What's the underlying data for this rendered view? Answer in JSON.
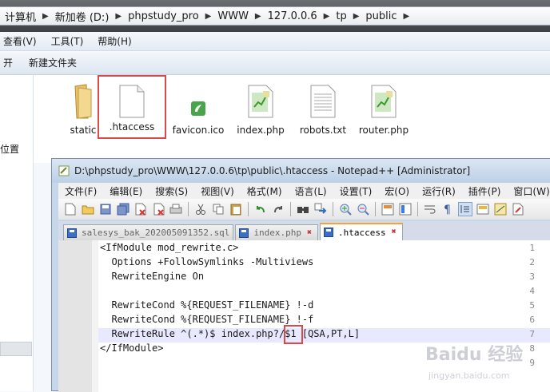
{
  "explorer": {
    "breadcrumbs": [
      "计算机",
      "新加卷 (D:)",
      "phpstudy_pro",
      "WWW",
      "127.0.0.6",
      "tp",
      "public"
    ],
    "menu": [
      "查看(V)",
      "工具(T)",
      "帮助(H)"
    ],
    "commands": [
      "开",
      "新建文件夹"
    ],
    "nav_label": "位置",
    "files": [
      {
        "name": "static",
        "icon": "folder-icon"
      },
      {
        "name": ".htaccess",
        "icon": "blank-file-icon"
      },
      {
        "name": "favicon.ico",
        "icon": "favicon-icon"
      },
      {
        "name": "index.php",
        "icon": "php-file-icon"
      },
      {
        "name": "robots.txt",
        "icon": "text-file-icon"
      },
      {
        "name": "router.php",
        "icon": "php-file-icon"
      }
    ]
  },
  "notepad": {
    "title": "D:\\phpstudy_pro\\WWW\\127.0.0.6\\tp\\public\\.htaccess - Notepad++ [Administrator]",
    "menu": [
      "文件(F)",
      "编辑(E)",
      "搜索(S)",
      "视图(V)",
      "格式(M)",
      "语言(L)",
      "设置(T)",
      "宏(O)",
      "运行(R)",
      "插件(P)",
      "窗口(W)",
      "?"
    ],
    "tabs": [
      "salesys_bak_202005091352.sql",
      "index.php",
      ".htaccess"
    ],
    "active_tab": ".htaccess",
    "line_numbers": [
      "1",
      "2",
      "3",
      "4",
      "5",
      "6",
      "7",
      "8",
      "9"
    ],
    "lines": [
      "<IfModule mod_rewrite.c>",
      "  Options +FollowSymlinks -Multiviews",
      "  RewriteEngine On",
      "",
      "  RewriteCond %{REQUEST_FILENAME} !-d",
      "  RewriteCond %{REQUEST_FILENAME} !-f",
      "  RewriteRule ^(.*)$ index.php?/$1 [QSA,PT,L]",
      "</IfModule>",
      ""
    ]
  },
  "watermark": {
    "brand": "Baidu 经验",
    "url": "jingyan.baidu.com"
  },
  "colors": {
    "highlight_box": "#d94a4a",
    "tab_accent": "#f3a33a"
  }
}
